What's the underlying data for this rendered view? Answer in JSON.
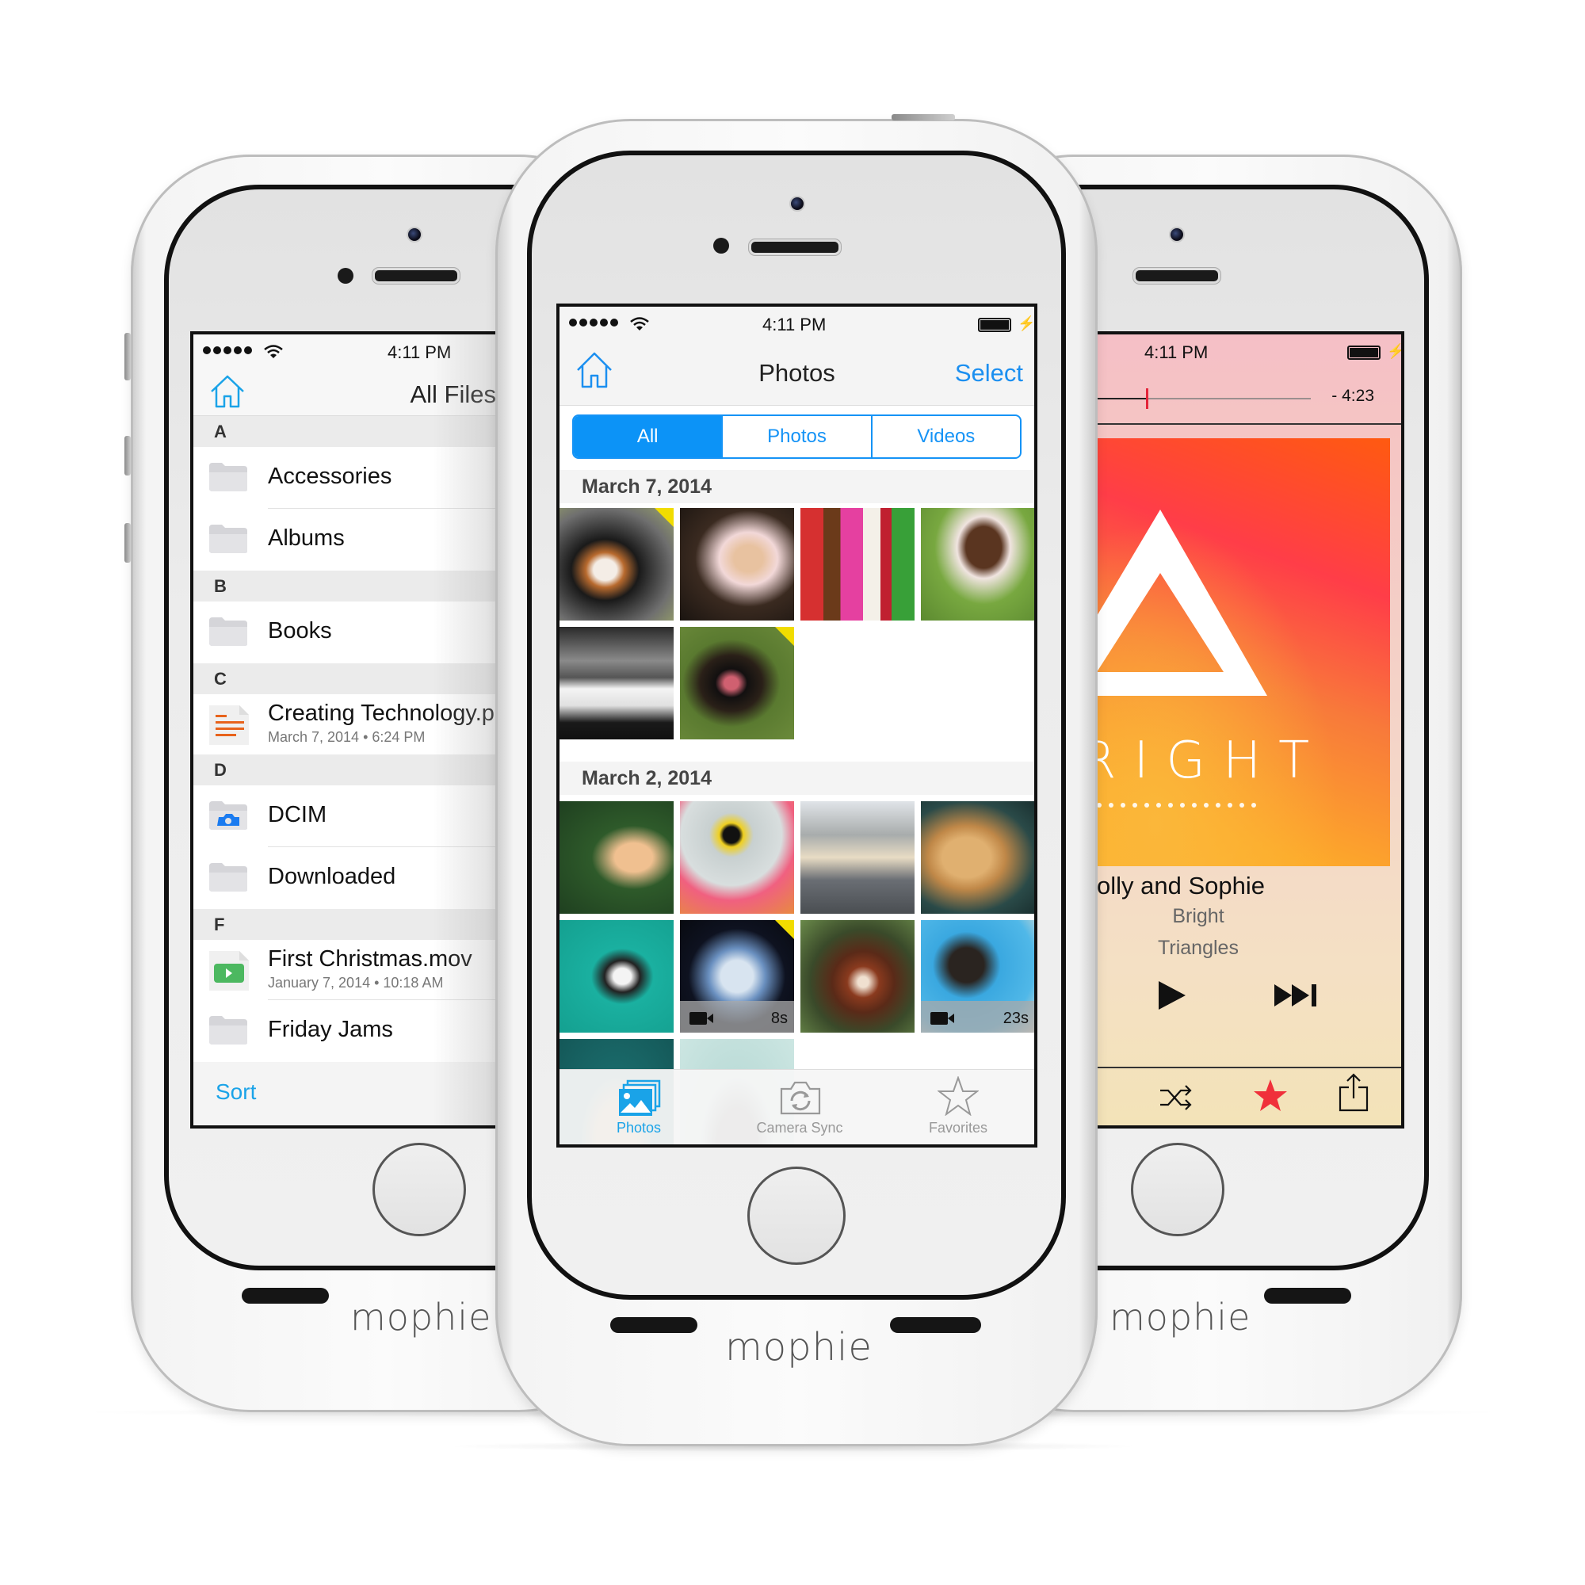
{
  "brand": "mophie",
  "left_phone": {
    "status_bar": {
      "signal_dots": 5,
      "time": "4:11 PM"
    },
    "nav": {
      "home_icon": "home-icon",
      "title": "All Files"
    },
    "sections": [
      {
        "letter": "A",
        "items": [
          {
            "name": "Accessories",
            "icon": "folder-icon"
          },
          {
            "name": "Albums",
            "icon": "folder-icon"
          }
        ]
      },
      {
        "letter": "B",
        "items": [
          {
            "name": "Books",
            "icon": "folder-icon"
          }
        ]
      },
      {
        "letter": "C",
        "items": [
          {
            "name": "Creating Technology.p",
            "detail": "March 7, 2014 • 6:24 PM",
            "icon": "document-icon"
          }
        ]
      },
      {
        "letter": "D",
        "items": [
          {
            "name": "DCIM",
            "icon": "camera-folder-icon"
          },
          {
            "name": "Downloaded",
            "icon": "folder-icon"
          }
        ]
      },
      {
        "letter": "F",
        "items": [
          {
            "name": "First Christmas.mov",
            "detail": "January 7, 2014 • 10:18 AM",
            "icon": "video-file-icon"
          },
          {
            "name": "Friday Jams",
            "icon": "folder-icon"
          }
        ]
      }
    ],
    "toolbar": {
      "sort_label": "Sort"
    }
  },
  "center_phone": {
    "status_bar": {
      "signal_dots": 5,
      "time": "4:11 PM",
      "battery": "charging"
    },
    "nav": {
      "home_icon": "home-icon",
      "title": "Photos",
      "select_label": "Select"
    },
    "segments": [
      {
        "label": "All",
        "active": true
      },
      {
        "label": "Photos",
        "active": false
      },
      {
        "label": "Videos",
        "active": false
      }
    ],
    "groups": [
      {
        "date": "March 7, 2014",
        "thumbs": [
          {
            "subject": "Bernese mountain dog",
            "new": true
          },
          {
            "subject": "Smiling girl with plate"
          },
          {
            "subject": "Children in costumes"
          },
          {
            "subject": "Girl blowing bubbles"
          },
          {
            "subject": "Space shuttle in hangar"
          },
          {
            "subject": "Doberman on grass",
            "new": true
          }
        ]
      },
      {
        "date": "March 2, 2014",
        "thumbs": [
          {
            "subject": "Egret"
          },
          {
            "subject": "Pelican close-up"
          },
          {
            "subject": "Polar bear"
          },
          {
            "subject": "Lioness"
          },
          {
            "subject": "Penguin swimming"
          },
          {
            "subject": "Jellyfish",
            "new": true,
            "video": true,
            "duration": "8s"
          },
          {
            "subject": "Red panda"
          },
          {
            "subject": "Sea lion",
            "video": true,
            "duration": "23s"
          },
          {
            "subject": "Lion"
          },
          {
            "subject": "Seal"
          }
        ]
      }
    ],
    "tabs": [
      {
        "label": "Photos",
        "icon": "photos-stack-icon",
        "active": true
      },
      {
        "label": "Camera Sync",
        "icon": "camera-sync-icon",
        "active": false
      },
      {
        "label": "Favorites",
        "icon": "star-outline-icon",
        "active": false
      }
    ]
  },
  "right_phone": {
    "status_bar": {
      "time": "4:11 PM",
      "battery": "charging"
    },
    "scrubber": {
      "progress": 0.23,
      "remaining": "- 4:23"
    },
    "album_art": {
      "word": "RIGHT"
    },
    "now_playing": {
      "song": "olly and Sophie",
      "artist": "Bright",
      "album": "Triangles"
    },
    "controls": {
      "play": "play-icon",
      "next": "next-track-icon"
    },
    "actions": [
      {
        "icon": "shuffle-icon"
      },
      {
        "icon": "star-filled-icon",
        "color": "#f0303a"
      },
      {
        "icon": "share-icon"
      }
    ]
  },
  "colors": {
    "accent_blue": "#1593f6",
    "link_blue": "#1aa3e8",
    "new_badge_yellow": "#f1dc00",
    "scrub_red": "#e3253a"
  }
}
